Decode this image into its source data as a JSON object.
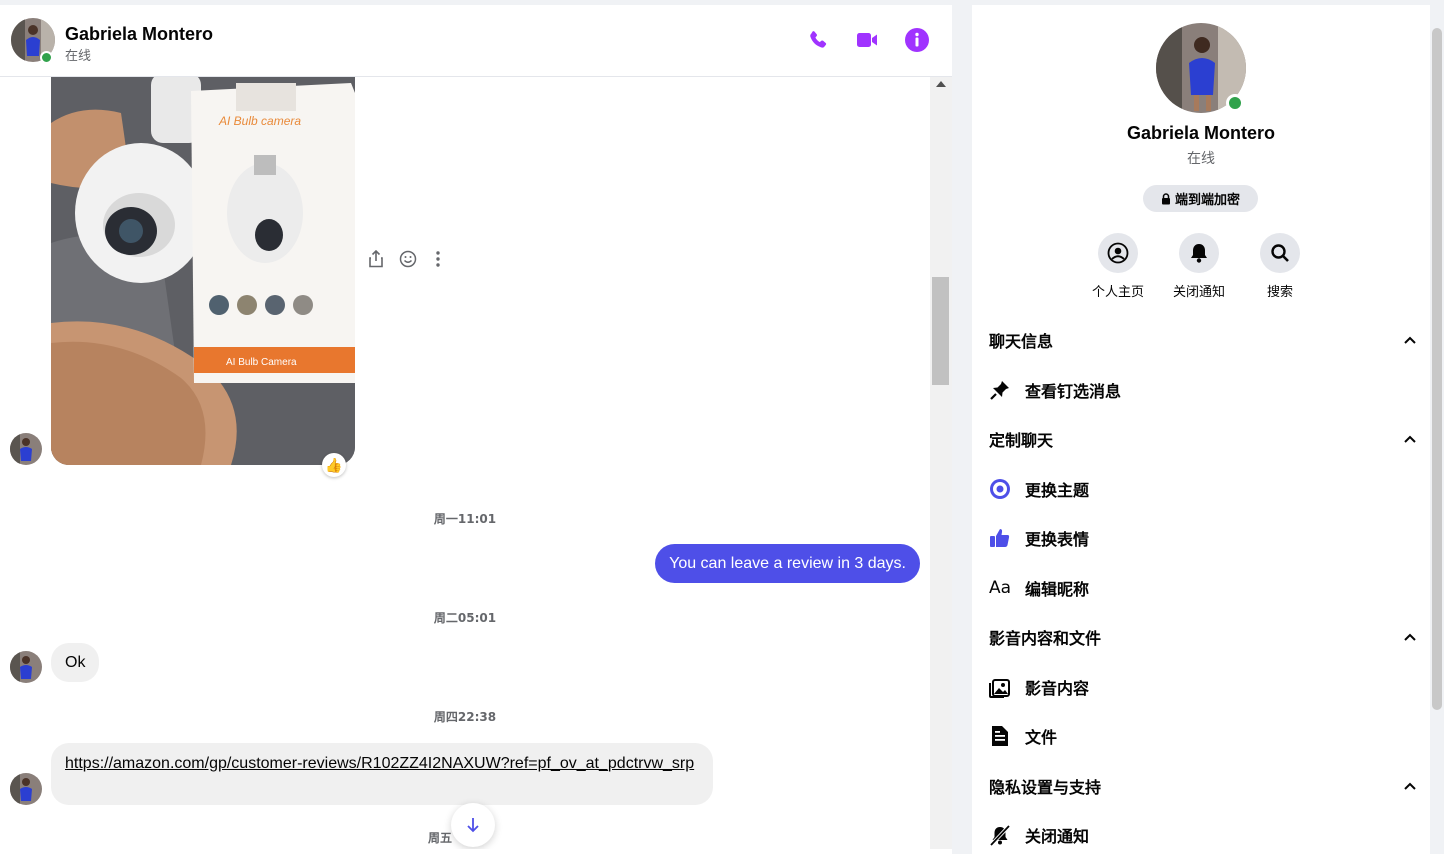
{
  "contact": {
    "name": "Gabriela Montero",
    "status": "在线"
  },
  "header": {
    "call_icon": "phone-icon",
    "video_icon": "video-camera-icon",
    "info_icon": "info-icon"
  },
  "messages": {
    "photo": {
      "box_title": "AI Bulb camera",
      "box_footer": "AI Bulb Camera",
      "reaction": "👍"
    },
    "time_1": "周一11:01",
    "outgoing_1": "You can leave a review in 3 days.",
    "time_2": "周二05:01",
    "incoming_ok": "Ok",
    "time_3": "周四22:38",
    "link_text": "https://amazon.com/gp/customer-reviews/R102ZZ4I2NAXUW?ref=pf_ov_at_pdctrvw_srp",
    "time_4": "周五"
  },
  "info_panel": {
    "e2e_label": "端到端加密",
    "quick_actions": [
      {
        "label": "个人主页",
        "icon": "profile-icon"
      },
      {
        "label": "关闭通知",
        "icon": "bell-icon"
      },
      {
        "label": "搜索",
        "icon": "search-icon"
      }
    ],
    "sections": [
      {
        "title": "聊天信息",
        "items": [
          {
            "label": "查看钉选消息",
            "icon": "pin-icon"
          }
        ]
      },
      {
        "title": "定制聊天",
        "items": [
          {
            "label": "更换主题",
            "icon": "theme-icon"
          },
          {
            "label": "更换表情",
            "icon": "thumbs-up-icon"
          },
          {
            "label": "编辑昵称",
            "icon": "text-aa-icon"
          }
        ]
      },
      {
        "title": "影音内容和文件",
        "items": [
          {
            "label": "影音内容",
            "icon": "media-icon"
          },
          {
            "label": "文件",
            "icon": "file-icon"
          }
        ]
      },
      {
        "title": "隐私设置与支持",
        "items": [
          {
            "label": "关闭通知",
            "icon": "bell-off-icon"
          }
        ]
      }
    ],
    "text_icon": "Aa"
  },
  "colors": {
    "accent": "#4e4fe8",
    "icon_purple": "#a033ff",
    "online": "#31a24c"
  }
}
